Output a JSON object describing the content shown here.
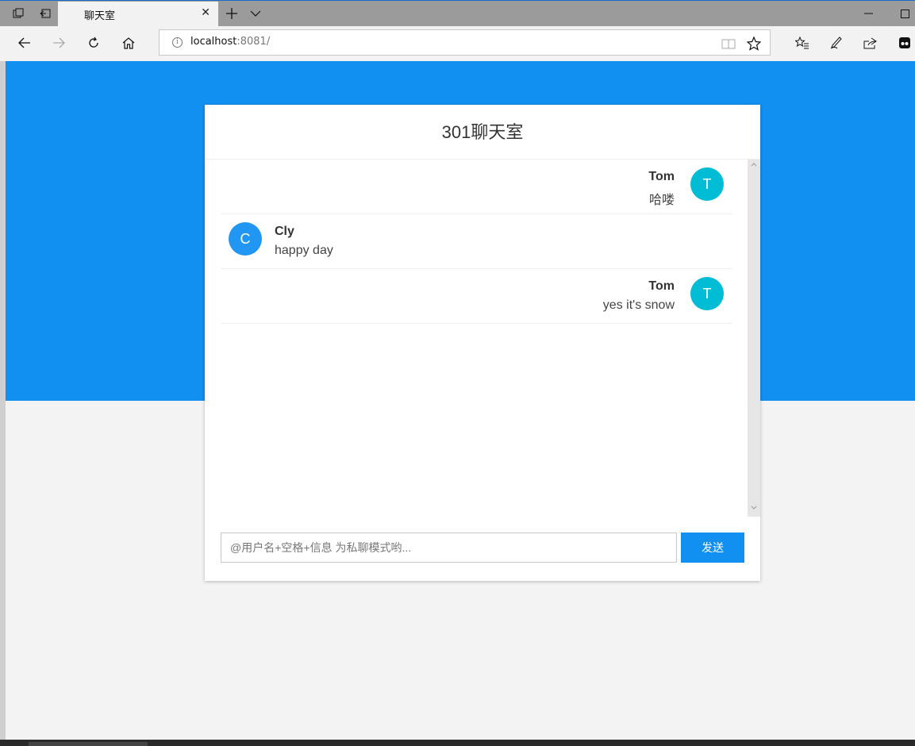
{
  "browser": {
    "tab_title": "聊天室",
    "url_host": "localhost",
    "url_rest": ":8081/"
  },
  "chat": {
    "title": "301聊天室",
    "messages": [
      {
        "side": "right",
        "avatar": "T",
        "name": "Tom",
        "text": "哈喽",
        "avatar_color": "#00bcd4"
      },
      {
        "side": "left",
        "avatar": "C",
        "name": "Cly",
        "text": "happy day",
        "avatar_color": "#2196f3"
      },
      {
        "side": "right",
        "avatar": "T",
        "name": "Tom",
        "text": "yes it's snow",
        "avatar_color": "#00bcd4"
      }
    ],
    "input_placeholder": "@用户名+空格+信息 为私聊模式哟...",
    "input_value": "",
    "send_label": "发送"
  },
  "colors": {
    "primary": "#1190f2",
    "background": "#f3f3f3"
  }
}
